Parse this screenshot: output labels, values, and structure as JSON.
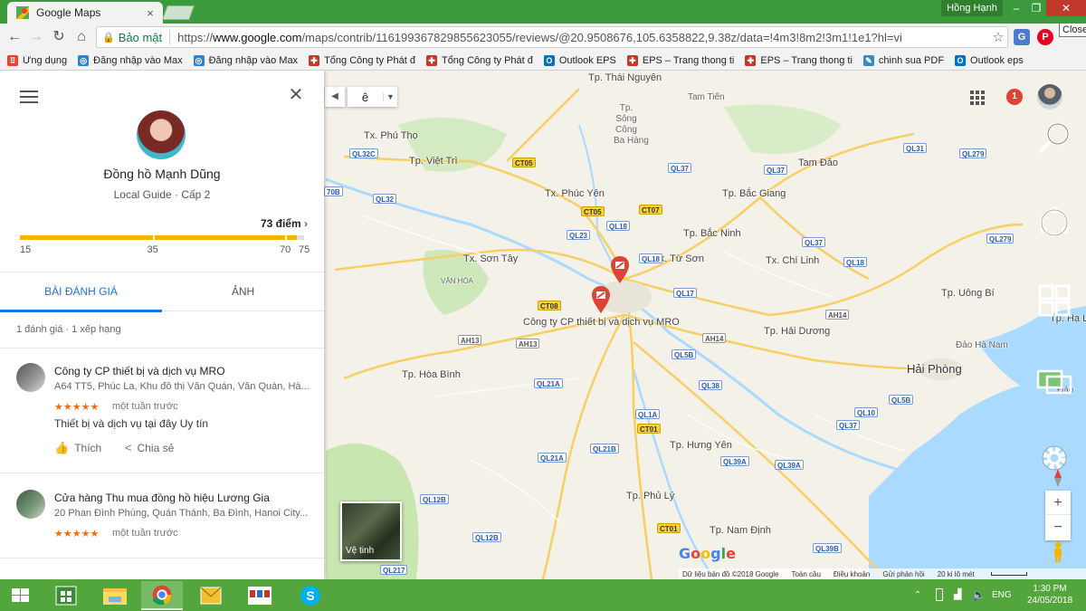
{
  "browser": {
    "tab_title": "Google Maps",
    "user_name": "Hồng Hạnh",
    "close_tooltip": "Close",
    "secure_label": "Bảo mật",
    "url_prefix": "https://",
    "url_host": "www.google.com",
    "url_path": "/maps/contrib/116199367829855623055/reviews/@20.9508676,105.6358822,9.38z/data=!4m3!8m2!3m1!1e1?hl=vi",
    "bookmarks": [
      {
        "label": "Ứng dụng",
        "icon": "apps-grid-icon"
      },
      {
        "label": "Đăng nhập vào Max",
        "icon": "maxthon-icon"
      },
      {
        "label": "Đăng nhập vào Max",
        "icon": "maxthon-icon"
      },
      {
        "label": "Tổng Công ty Phát đ",
        "icon": "evn-icon"
      },
      {
        "label": "Tổng Công ty Phát đ",
        "icon": "evn-icon"
      },
      {
        "label": "Outlook EPS",
        "icon": "outlook-icon"
      },
      {
        "label": "EPS – Trang thong ti",
        "icon": "evn-icon"
      },
      {
        "label": "EPS – Trang thong ti",
        "icon": "evn-icon"
      },
      {
        "label": "chinh sua PDF",
        "icon": "pen-icon"
      },
      {
        "label": "Outlook eps",
        "icon": "outlook-icon"
      }
    ]
  },
  "profile": {
    "name": "Đồng hồ Mạnh Dũng",
    "subtitle": "Local Guide · Cấp 2",
    "points_label": "73 điểm",
    "points_value": 73,
    "scale_max": 75,
    "ticks": [
      "15",
      "35",
      "70",
      "75"
    ],
    "tick_values": [
      15,
      35,
      70,
      75
    ]
  },
  "tabs": [
    {
      "label": "BÀI ĐÁNH GIÁ",
      "active": true
    },
    {
      "label": "ẢNH",
      "active": false
    }
  ],
  "review_summary": "1 đánh giá · 1 xếp hạng",
  "reviews": [
    {
      "title": "Công ty CP thiết bị và dịch vụ MRO",
      "address": "A64 TT5, Phúc La, Khu đô thị Văn Quán, Văn Quán, Hà...",
      "stars": "★★★★★",
      "time": "một tuần trước",
      "text": "Thiết bị và dịch vụ tại đây Uy tín",
      "like_label": "Thích",
      "share_label": "Chia sẻ"
    },
    {
      "title": "Cửa hàng Thu mua đồng hồ hiệu Lương Gia",
      "address": "20 Phan Đình Phùng, Quán Thánh, Ba Đình, Hanoi City...",
      "stars": "★★★★★",
      "time": "một tuần trước"
    }
  ],
  "map": {
    "lang_char": "ê",
    "notif_count": "1",
    "satellite_label": "Vệ tinh",
    "google_logo": "Google",
    "attribution": [
      "Dữ liệu bản đồ ©2018 Google",
      "Toàn cầu",
      "Điều khoản",
      "Gửi phản hồi",
      "20 ki lô mét"
    ],
    "places": {
      "thai_nguyen": "Tp. Thái Nguyên",
      "tam_tien": "Tam Tiến",
      "song_cong": "Tp. Sông Công",
      "ba_hang": "Ba Hàng",
      "phu_tho": "Tx. Phú Thọ",
      "viet_tri": "Tp. Việt Trì",
      "tam_dao": "Tam Đảo",
      "phuc_yen": "Tx. Phúc Yên",
      "bac_giang": "Tp. Bắc Giang",
      "bac_ninh": "Tp. Bắc Ninh",
      "son_tay": "Tx. Sơn Tây",
      "tu_son": "Tx. Từ Sơn",
      "chi_linh": "Tx. Chí Linh",
      "van_hoa": "VĂN HÓA",
      "uong_bi": "Tp. Uông Bí",
      "ha_long": "Tp. Hạ Lo",
      "mro_label": "Công ty CP thiết bị và dịch vụ MRO",
      "hai_duong": "Tp. Hải Dương",
      "dao_ha_nam": "Đảo Hà Nam",
      "hai_phong": "Hải Phòng",
      "hoa_binh": "Tp. Hòa Bình",
      "dao_cat": "Đảo",
      "hung_yen": "Tp. Hưng Yên",
      "phu_ly": "Tp. Phủ Lý",
      "nam_dinh": "Tp. Nam Định"
    },
    "shields": {
      "ql32c": "QL32C",
      "ct05a": "CT05",
      "ct05b": "CT05",
      "ql37a": "QL37",
      "ql37b": "QL37",
      "ql31": "QL31",
      "ql279a": "QL279",
      "ql279b": "QL279",
      "ql70b": "70B",
      "ql32": "QL32",
      "ct07": "CT07",
      "ql18a": "QL18",
      "ql23": "QL23",
      "ql37c": "QL37",
      "ql18b": "QL18",
      "ql18c": "QL18",
      "ct08": "CT08",
      "ql17": "QL17",
      "ah14a": "AH14",
      "ah13a": "AH13",
      "ah13b": "AH13",
      "ah14b": "AH14",
      "ql5b": "QL5B",
      "ql38": "QL38",
      "ql21a": "QL21A",
      "ql5b2": "QL5B",
      "ql10": "QL10",
      "ql1a": "QL1A",
      "ct01a": "CT01",
      "ql37d": "QL37",
      "ql21b": "QL21B",
      "ql39a1": "QL39A",
      "ql39a2": "QL39A",
      "ql21a2": "QL21A",
      "ql12b": "QL12B",
      "ct01b": "CT01",
      "ql12b2": "QL12B",
      "ql39b": "QL39B",
      "ql217": "QL217"
    },
    "colors": {
      "land": "#f4f1e8",
      "water": "#aadaff",
      "highway": "#f6cf65",
      "green": "#c8e6b0"
    }
  },
  "taskbar": {
    "lang": "ENG",
    "time": "1:30 PM",
    "date": "24/05/2018"
  }
}
